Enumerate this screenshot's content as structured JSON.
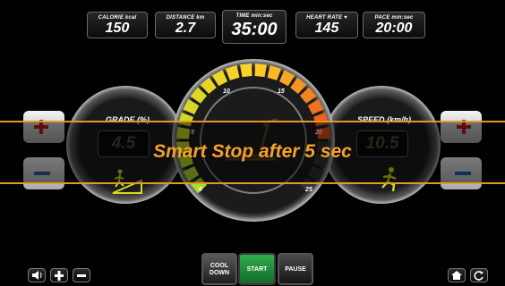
{
  "stats": [
    {
      "label": "CALORIE kcal",
      "value": "150"
    },
    {
      "label": "DISTANCE km",
      "value": "2.7"
    },
    {
      "label": "TIME min:sec",
      "value": "35:00"
    },
    {
      "label": "HEART RATE ♥",
      "value": "145"
    },
    {
      "label": "PACE min:sec",
      "value": "20:00"
    }
  ],
  "grade": {
    "label": "GRADE (%)",
    "value": "4.5",
    "plus": "+",
    "minus": "−"
  },
  "speed": {
    "label": "SPEED (km/h)",
    "value": "10.5",
    "plus": "+",
    "minus": "−"
  },
  "gauge": {
    "ticks": [
      "0",
      "5",
      "10",
      "15",
      "20",
      "25"
    ],
    "level_fraction": 0.82
  },
  "banner": {
    "text": "Smart Stop after 5 sec"
  },
  "controls": {
    "cool_down": "COOL DOWN",
    "start": "START",
    "pause": "PAUSE"
  },
  "audio": {
    "plus": "+",
    "minus": "−"
  },
  "colors": {
    "accent_orange": "#e39a24",
    "start_green": "#1f8a3a",
    "lcd_text": "#4c4c30"
  },
  "icons": [
    "speaker-icon",
    "home-icon",
    "refresh-icon",
    "grade-walker-icon",
    "runner-icon",
    "treadmill-icon"
  ]
}
